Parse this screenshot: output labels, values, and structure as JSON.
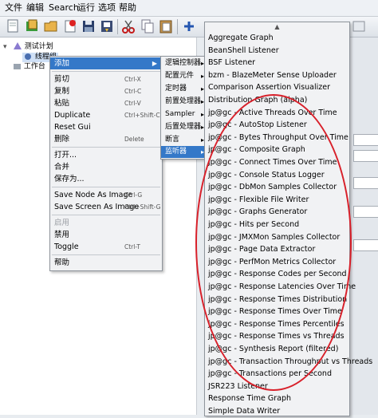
{
  "menubar": [
    "文件",
    "编辑",
    "Search",
    "运行",
    "选项",
    "帮助"
  ],
  "toolbar": {
    "icons": [
      "new-plan-icon",
      "templates-icon",
      "open-icon",
      "close-icon",
      "save-icon",
      "save-screenshot-icon",
      "cut-icon",
      "copy-icon",
      "paste-icon",
      "expand-icon"
    ]
  },
  "tree": {
    "root": "测试计划",
    "child1": "线程组",
    "child2": "工作台"
  },
  "context_menu": {
    "items": [
      {
        "label": "添加",
        "shortcut": "",
        "submenu": true,
        "highlight": true
      },
      {
        "sep": true
      },
      {
        "label": "剪切",
        "shortcut": "Ctrl-X"
      },
      {
        "label": "复制",
        "shortcut": "Ctrl-C"
      },
      {
        "label": "粘贴",
        "shortcut": "Ctrl-V"
      },
      {
        "label": "Duplicate",
        "shortcut": "Ctrl+Shift-C"
      },
      {
        "label": "Reset Gui",
        "shortcut": ""
      },
      {
        "label": "删除",
        "shortcut": "Delete"
      },
      {
        "sep": true
      },
      {
        "label": "打开...",
        "shortcut": ""
      },
      {
        "label": "合并",
        "shortcut": ""
      },
      {
        "label": "保存为...",
        "shortcut": ""
      },
      {
        "sep": true
      },
      {
        "label": "Save Node As Image",
        "shortcut": "Ctrl-G"
      },
      {
        "label": "Save Screen As Image",
        "shortcut": "Ctrl+Shift-G"
      },
      {
        "sep": true
      },
      {
        "label": "启用",
        "shortcut": "",
        "disabled": true
      },
      {
        "label": "禁用",
        "shortcut": ""
      },
      {
        "label": "Toggle",
        "shortcut": "Ctrl-T"
      },
      {
        "sep": true
      },
      {
        "label": "帮助",
        "shortcut": ""
      }
    ]
  },
  "add_submenu": {
    "items": [
      {
        "label": "逻辑控制器",
        "highlight": false
      },
      {
        "label": "配置元件"
      },
      {
        "label": "定时器"
      },
      {
        "label": "前置处理器"
      },
      {
        "label": "Sampler"
      },
      {
        "label": "后置处理器"
      },
      {
        "label": "断言"
      },
      {
        "label": "监听器",
        "highlight": true
      }
    ]
  },
  "listener_menu": {
    "scroll_up": "▲",
    "items": [
      "Aggregate Graph",
      "BeanShell Listener",
      "BSF Listener",
      "bzm - BlazeMeter Sense Uploader",
      "Comparison Assertion Visualizer",
      "Distribution Graph (alpha)",
      "jp@gc - Active Threads Over Time",
      "jp@gc - AutoStop Listener",
      "jp@gc - Bytes Throughput Over Time",
      "jp@gc - Composite Graph",
      "jp@gc - Connect Times Over Time",
      "jp@gc - Console Status Logger",
      "jp@gc - DbMon Samples Collector",
      "jp@gc - Flexible File Writer",
      "jp@gc - Graphs Generator",
      "jp@gc - Hits per Second",
      "jp@gc - JMXMon Samples Collector",
      "jp@gc - Page Data Extractor",
      "jp@gc - PerfMon Metrics Collector",
      "jp@gc - Response Codes per Second",
      "jp@gc - Response Latencies Over Time",
      "jp@gc - Response Times Distribution",
      "jp@gc - Response Times Over Time",
      "jp@gc - Response Times Percentiles",
      "jp@gc - Response Times vs Threads",
      "jp@gc - Synthesis Report (filtered)",
      "jp@gc - Transaction Throughput vs Threads",
      "jp@gc - Transactions per Second",
      "JSR223 Listener",
      "Response Time Graph",
      "Simple Data Writer"
    ]
  },
  "colors": {
    "highlight": "#3478c8",
    "annotation": "#d8202a"
  }
}
